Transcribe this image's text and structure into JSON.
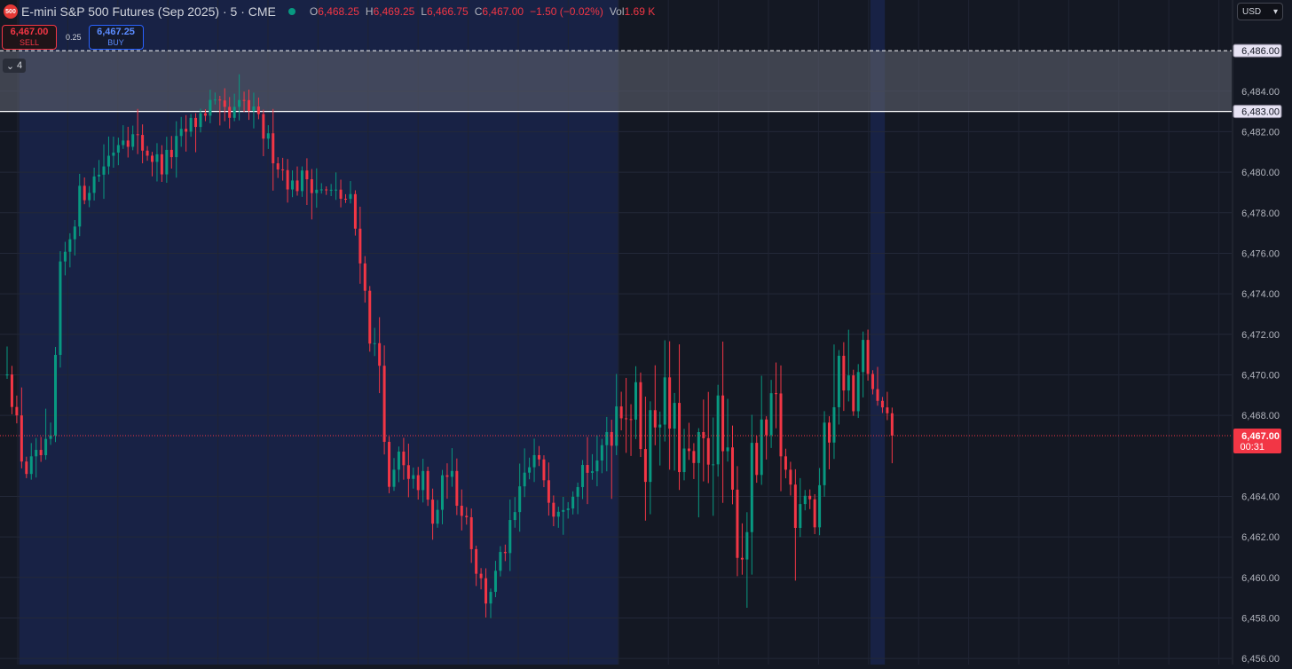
{
  "header": {
    "symbol_badge": "500",
    "title": "E-mini S&P 500 Futures (Sep 2025) · 5 · CME",
    "ohlc": [
      {
        "label": "O",
        "value": "6,468.25"
      },
      {
        "label": "H",
        "value": "6,469.25"
      },
      {
        "label": "L",
        "value": "6,466.75"
      },
      {
        "label": "C",
        "value": "6,467.00"
      },
      {
        "label": "",
        "value": "−1.50 (−0.02%)"
      },
      {
        "label": "Vol",
        "value": "1.69 K"
      }
    ]
  },
  "trade": {
    "sell_price": "6,467.00",
    "sell_label": "SELL",
    "spread": "0.25",
    "buy_price": "6,467.25",
    "buy_label": "BUY"
  },
  "collapse_label": "4",
  "currency": "USD",
  "colors": {
    "up": "#089981",
    "down": "#f23645",
    "session_bg": "#182245",
    "chart_bg": "#141823",
    "zone": "#5a5e6a"
  },
  "chart_data": {
    "type": "candlestick",
    "interval_minutes": 5,
    "ylim": [
      6455.7,
      6488.5
    ],
    "y_ticks": [
      6484,
      6482,
      6480,
      6478,
      6476,
      6474,
      6472,
      6470,
      6468,
      6464,
      6462,
      6460,
      6458,
      6456
    ],
    "zone": {
      "top": 6486.0,
      "bottom": 6483.0,
      "top_label": "6,486.00",
      "bottom_label": "6,483.00"
    },
    "last_price": {
      "value": 6467.0,
      "label": "6,467.00",
      "countdown": "00:31"
    },
    "grid": true,
    "close_path": [
      [
        0,
        6470.5
      ],
      [
        3,
        6466.0
      ],
      [
        4,
        6465.3
      ],
      [
        9,
        6466.5
      ],
      [
        11,
        6475.0
      ],
      [
        15,
        6478.8
      ],
      [
        19,
        6480.0
      ],
      [
        24,
        6482.0
      ],
      [
        27,
        6481.5
      ],
      [
        32,
        6480.3
      ],
      [
        37,
        6482.0
      ],
      [
        42,
        6483.3
      ],
      [
        46,
        6482.6
      ],
      [
        49,
        6483.4
      ],
      [
        52,
        6482.4
      ],
      [
        56,
        6480.5
      ],
      [
        59,
        6479.3
      ],
      [
        62,
        6479.8
      ],
      [
        65,
        6479.0
      ],
      [
        69,
        6478.8
      ],
      [
        71,
        6478.5
      ],
      [
        73,
        6476.0
      ],
      [
        75,
        6472.0
      ],
      [
        77,
        6470.5
      ],
      [
        79,
        6464.0
      ],
      [
        81,
        6466.0
      ],
      [
        83,
        6464.5
      ],
      [
        86,
        6464.8
      ],
      [
        88,
        6462.5
      ],
      [
        91,
        6465.5
      ],
      [
        93,
        6464.0
      ],
      [
        95,
        6463.0
      ],
      [
        97,
        6460.5
      ],
      [
        99,
        6459.0
      ],
      [
        101,
        6460.0
      ],
      [
        103,
        6461.5
      ],
      [
        105,
        6463.0
      ],
      [
        107,
        6465.0
      ],
      [
        109,
        6465.8
      ],
      [
        111,
        6465.0
      ],
      [
        113,
        6463.5
      ],
      [
        116,
        6464.0
      ],
      [
        119,
        6465.5
      ],
      [
        122,
        6465.2
      ],
      [
        124,
        6467.5
      ],
      [
        127,
        6469.3
      ],
      [
        130,
        6468.0
      ],
      [
        132,
        6466.5
      ],
      [
        135,
        6469.0
      ],
      [
        138,
        6467.0
      ],
      [
        141,
        6465.0
      ],
      [
        144,
        6466.0
      ],
      [
        147,
        6467.5
      ],
      [
        150,
        6463.5
      ],
      [
        152,
        6461.5
      ],
      [
        154,
        6465.0
      ],
      [
        157,
        6466.7
      ],
      [
        159,
        6468.0
      ],
      [
        161,
        6465.0
      ],
      [
        163,
        6464.0
      ],
      [
        165,
        6465.0
      ],
      [
        167,
        6463.0
      ],
      [
        169,
        6466.0
      ],
      [
        171,
        6469.5
      ],
      [
        173,
        6470.5
      ],
      [
        175,
        6468.0
      ],
      [
        177,
        6471.5
      ],
      [
        179,
        6469.0
      ],
      [
        181,
        6468.0
      ],
      [
        183,
        6467.2
      ]
    ],
    "bar_count": 184,
    "sessions": [
      {
        "start_bar": 3,
        "end_bar": 126
      },
      {
        "start_bar": 179,
        "end_bar": 181
      }
    ]
  }
}
